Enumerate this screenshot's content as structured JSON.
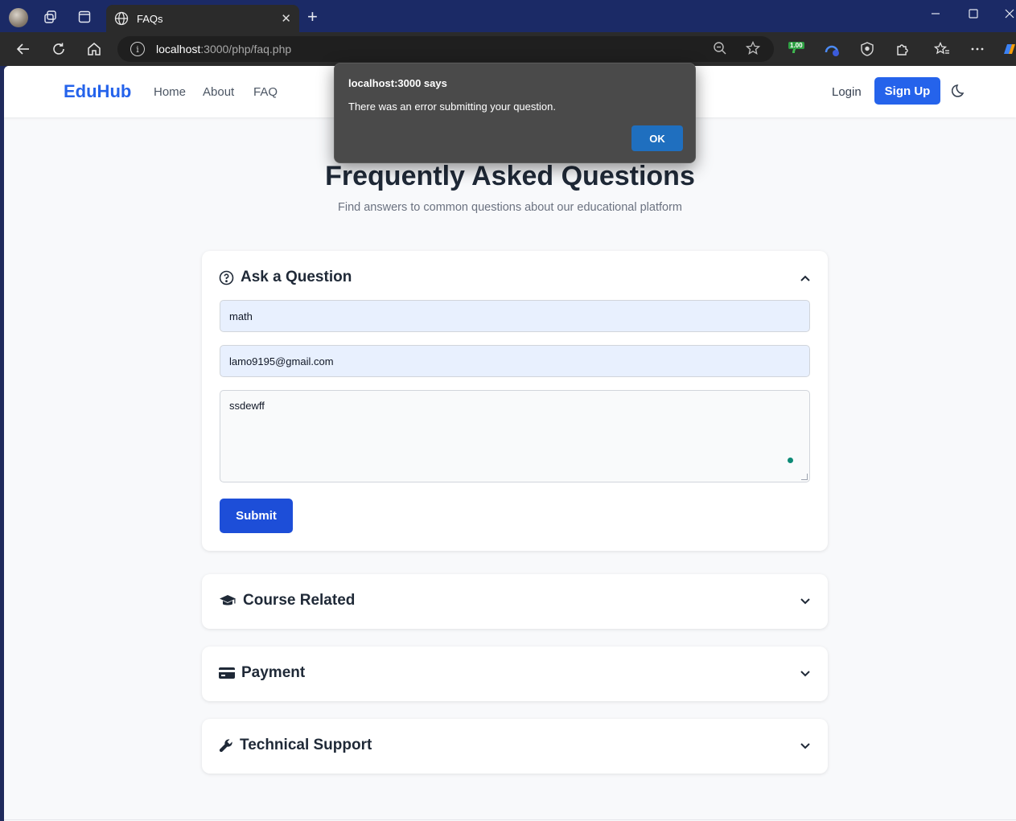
{
  "browser": {
    "tab_title": "FAQs",
    "url_host": "localhost",
    "url_rest": ":3000/php/faq.php",
    "extension_badge": "1.00"
  },
  "navbar": {
    "brand": "EduHub",
    "links": [
      "Home",
      "About",
      "FAQ"
    ],
    "login_label": "Login",
    "signup_label": "Sign Up"
  },
  "hero": {
    "title": "Frequently Asked Questions",
    "subtitle": "Find answers to common questions about our educational platform"
  },
  "ask_form": {
    "heading": "Ask a Question",
    "subject_value": "math",
    "email_value": "lamo9195@gmail.com",
    "question_value": "ssdewff",
    "submit_label": "Submit"
  },
  "sections": [
    {
      "label": "Course Related",
      "icon": "graduation-cap-icon"
    },
    {
      "label": "Payment",
      "icon": "credit-card-icon"
    },
    {
      "label": "Technical Support",
      "icon": "wrench-icon"
    }
  ],
  "dialog": {
    "title": "localhost:3000 says",
    "message": "There was an error submitting your question.",
    "ok_label": "OK"
  },
  "colors": {
    "brand": "#2563eb",
    "submit": "#1d4ed8",
    "dialog_bg": "#4a4a4a",
    "dialog_ok": "#1f6fbf",
    "titlebar": "#1b2a66"
  }
}
